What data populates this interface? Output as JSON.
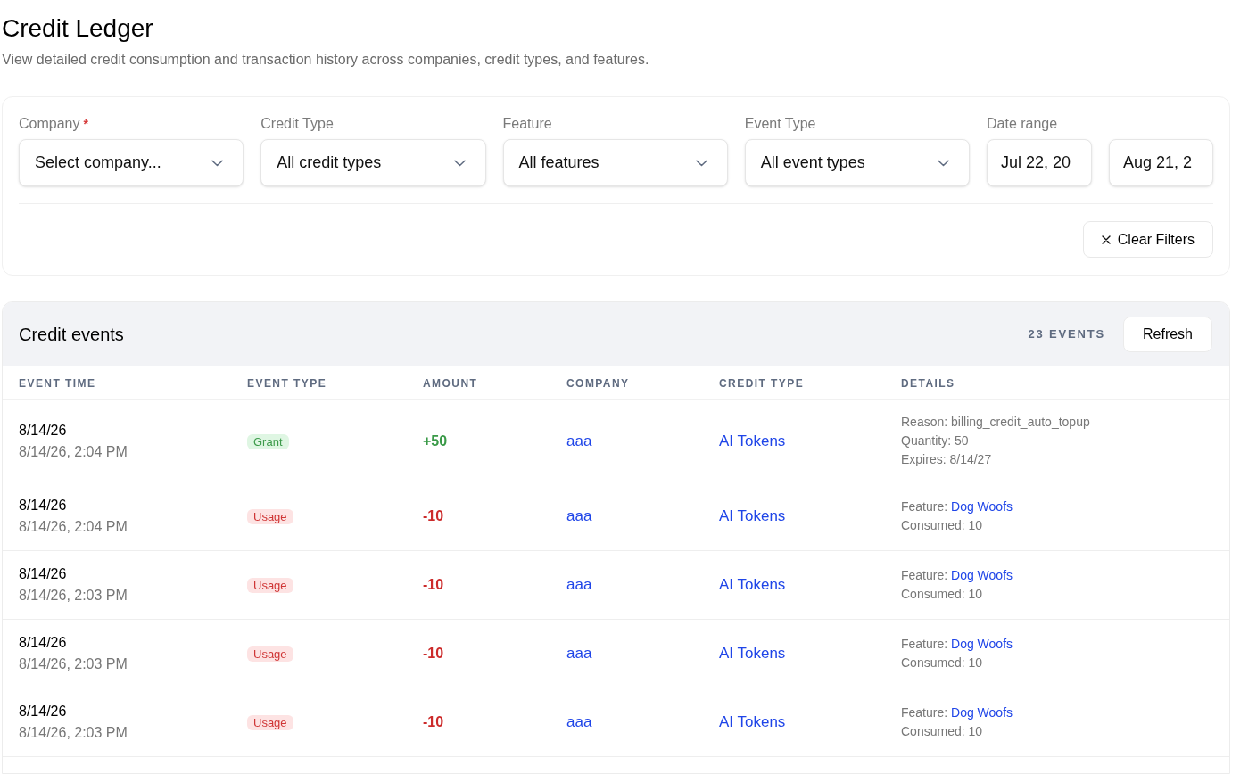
{
  "page": {
    "title": "Credit Ledger",
    "subtitle": "View detailed credit consumption and transaction history across companies, credit types, and features."
  },
  "filters": {
    "fields": [
      {
        "label": "Company",
        "required_mark": "*",
        "value": "Select company..."
      },
      {
        "label": "Credit Type",
        "value": "All credit types"
      },
      {
        "label": "Feature",
        "value": "All features"
      },
      {
        "label": "Event Type",
        "value": "All event types"
      }
    ],
    "date_range": {
      "label": "Date range",
      "start": "Jul 22, 20",
      "end": "Aug 21, 2"
    },
    "clear_button": "Clear Filters"
  },
  "events": {
    "title": "Credit events",
    "count": "23 EVENTS",
    "refresh_button": "Refresh",
    "columns": [
      "EVENT TIME",
      "EVENT TYPE",
      "AMOUNT",
      "COMPANY",
      "CREDIT TYPE",
      "DETAILS"
    ],
    "rows": [
      {
        "date": "8/14/26",
        "time": "8/14/26, 2:04 PM",
        "event_type": {
          "kind": "grant",
          "label": "Grant"
        },
        "amount": "+50",
        "company": "aaa",
        "credit_type": "AI Tokens",
        "details": [
          {
            "label": "Reason:",
            "value": "billing_credit_auto_topup",
            "link": false
          },
          {
            "label": "Quantity:",
            "value": "50",
            "link": false
          },
          {
            "label": "Expires:",
            "value": "8/14/27",
            "link": false
          }
        ]
      },
      {
        "date": "8/14/26",
        "time": "8/14/26, 2:04 PM",
        "event_type": {
          "kind": "usage",
          "label": "Usage"
        },
        "amount": "-10",
        "company": "aaa",
        "credit_type": "AI Tokens",
        "details": [
          {
            "label": "Feature:",
            "value": "Dog Woofs",
            "link": true
          },
          {
            "label": "Consumed:",
            "value": "10",
            "link": false
          }
        ]
      },
      {
        "date": "8/14/26",
        "time": "8/14/26, 2:03 PM",
        "event_type": {
          "kind": "usage",
          "label": "Usage"
        },
        "amount": "-10",
        "company": "aaa",
        "credit_type": "AI Tokens",
        "details": [
          {
            "label": "Feature:",
            "value": "Dog Woofs",
            "link": true
          },
          {
            "label": "Consumed:",
            "value": "10",
            "link": false
          }
        ]
      },
      {
        "date": "8/14/26",
        "time": "8/14/26, 2:03 PM",
        "event_type": {
          "kind": "usage",
          "label": "Usage"
        },
        "amount": "-10",
        "company": "aaa",
        "credit_type": "AI Tokens",
        "details": [
          {
            "label": "Feature:",
            "value": "Dog Woofs",
            "link": true
          },
          {
            "label": "Consumed:",
            "value": "10",
            "link": false
          }
        ]
      },
      {
        "date": "8/14/26",
        "time": "8/14/26, 2:03 PM",
        "event_type": {
          "kind": "usage",
          "label": "Usage"
        },
        "amount": "-10",
        "company": "aaa",
        "credit_type": "AI Tokens",
        "details": [
          {
            "label": "Feature:",
            "value": "Dog Woofs",
            "link": true
          },
          {
            "label": "Consumed:",
            "value": "10",
            "link": false
          }
        ]
      }
    ]
  }
}
